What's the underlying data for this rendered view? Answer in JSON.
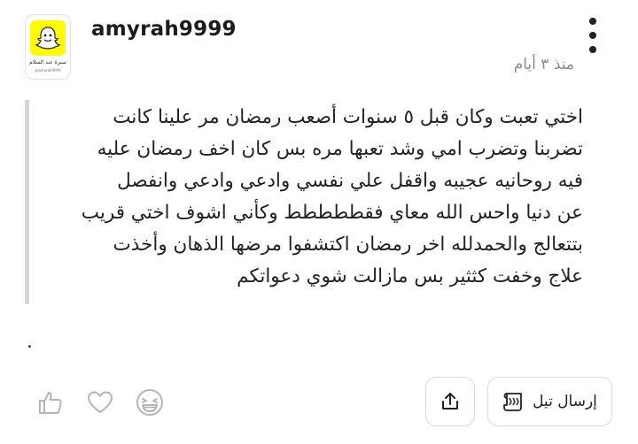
{
  "post": {
    "username": "amyrah9999",
    "timestamp": "منذ ٣ أيام",
    "avatar": {
      "caption": "سيرة عبد السلام",
      "caption_small": "@amyrah9999"
    },
    "text": "اختي تعبت وكان قبل ٥ سنوات أصعب رمضان مر علينا كانت\nتضربنا وتضرب امي وشد تعبها مره بس كان اخف رمضان عليه\nفيه روحانيه عجيبه واقفل علي نفسي وادعي وادعي وانفصل\nعن دنيا واحس الله معاي فقططططط وكأني اشوف اختي قريب\nبتتعالج والحمدلله اخر رمضان اكتشفوا مرضها الذهان وأخذت\nعلاج وخفت كثثير بس مازالت شوي دعواتكم",
    "trailing_dot": "."
  },
  "actions": {
    "send_label": "إرسال تيل",
    "icons": [
      "thumbs-up-icon",
      "heart-icon",
      "laughing-face-icon",
      "share-icon",
      "scroll-icon",
      "more-icon"
    ]
  },
  "colors": {
    "snap_yellow": "#fffc00",
    "quote_border": "#d6d6d6",
    "timestamp": "#8a8a8a"
  }
}
